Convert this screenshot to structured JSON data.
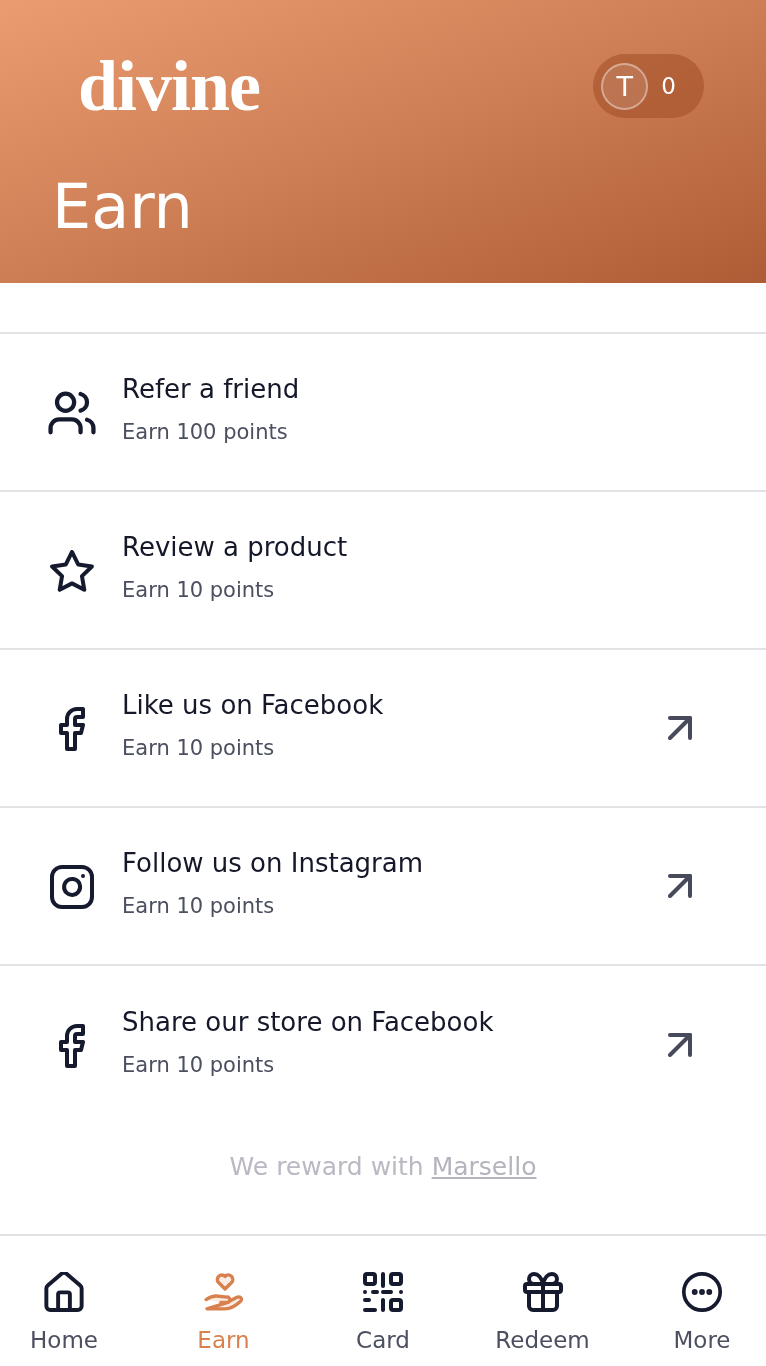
{
  "header": {
    "logo": "divine",
    "avatar_initial": "T",
    "points": "0",
    "title": "Earn"
  },
  "actions": [
    {
      "kind": "referral",
      "title": "Refer a friend",
      "subtitle": "Earn 100 points",
      "external": false
    },
    {
      "kind": "review",
      "title": "Review a product",
      "subtitle": "Earn 10 points",
      "external": false
    },
    {
      "kind": "facebook",
      "title": "Like us on Facebook",
      "subtitle": "Earn 10 points",
      "external": true
    },
    {
      "kind": "instagram",
      "title": "Follow us on Instagram",
      "subtitle": "Earn 10 points",
      "external": true
    },
    {
      "kind": "facebook",
      "title": "Share our store on Facebook",
      "subtitle": "Earn 10 points",
      "external": true
    }
  ],
  "footer": {
    "text": "We reward with",
    "link": "Marsello"
  },
  "nav": [
    {
      "label": "Home",
      "selected": false
    },
    {
      "label": "Earn",
      "selected": true
    },
    {
      "label": "Card",
      "selected": false
    },
    {
      "label": "Redeem",
      "selected": false
    },
    {
      "label": "More",
      "selected": false
    }
  ]
}
